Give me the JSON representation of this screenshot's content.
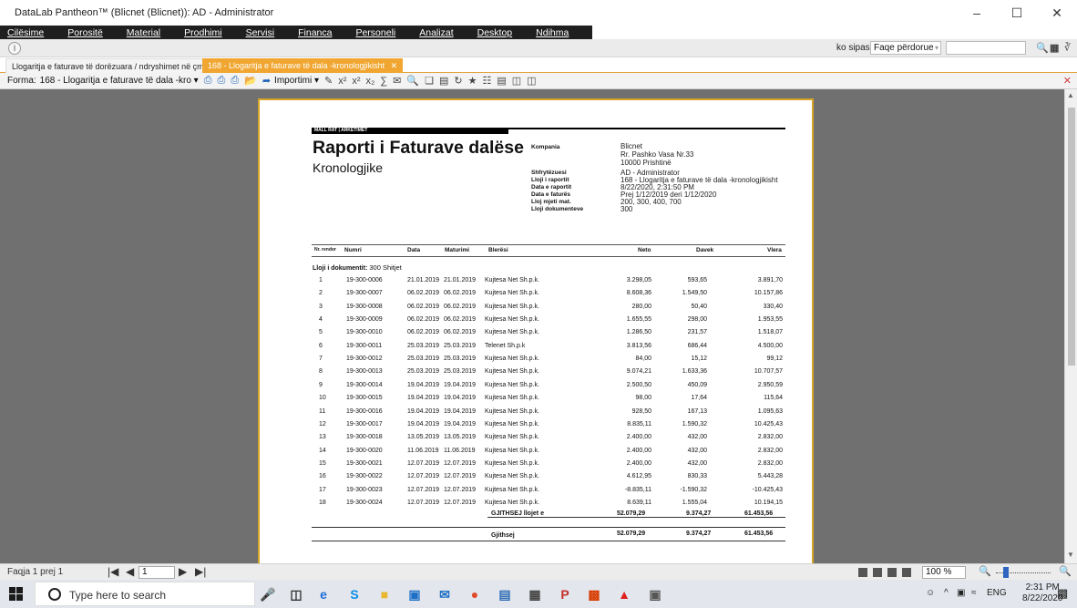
{
  "window": {
    "title": "DataLab Pantheon™  (Blicnet (Blicnet)): AD - Administrator",
    "minimize": "–",
    "maximize": "☐",
    "close": "✕"
  },
  "menu": [
    "Cilësime",
    "Porositë",
    "Material",
    "Prodhimi",
    "Servisi",
    "Financa",
    "Personeli",
    "Analizat",
    "Desktop",
    "Ndihma"
  ],
  "subbar": {
    "circle": "I",
    "sort_label": "ko sipas",
    "sort_value": "Faqe përdorue",
    "search_value": ""
  },
  "tabs": [
    {
      "label": "Llogaritja e faturave të dorëzuara / ndryshimet në çmim"
    },
    {
      "label": "168 - Llogaritja e faturave të dala  -kronologjikisht",
      "close": "✕"
    }
  ],
  "toolbar": {
    "forma_label": "Forma:",
    "forma_value": "168 - Llogaritja e faturave të dala  -kro ▾",
    "import_label": "Importimi ▾"
  },
  "report": {
    "kicker": "MALL RAT | ARKETIMET",
    "title": "Raporti i Faturave dalëse",
    "subtitle": "Kronologjike",
    "meta_labels": {
      "company": "Kompania",
      "user": "Shfrytëzuesi",
      "report_type": "Lloji i raportit",
      "report_date": "Data e raportit",
      "invoice_date": "Data e faturës",
      "account_type": "Lloj mjeti mat.",
      "doc_type": "Lloji dokumenteve"
    },
    "meta_values": {
      "company_name": "Blicnet",
      "company_addr1": "Rr. Pashko Vasa Nr.33",
      "company_addr2": "10000 Prishtinë",
      "user": "AD - Administrator",
      "report_type": "168 - Llogaritja e faturave të dala  -kronologjikisht",
      "report_date": "8/22/2020, 2:31:50 PM",
      "invoice_date": "Prej 1/12/2019 deri 1/12/2020",
      "account_type": "200, 300, 400, 700",
      "doc_type": "300"
    },
    "columns": [
      "Nr. rendor",
      "Numri",
      "Data",
      "Maturimi",
      "Blerësi",
      "Neto",
      "Davek",
      "Vlera"
    ],
    "group_label": "Lloji i dokumentit:",
    "group_value": "300   Shitjet",
    "rows": [
      [
        "1",
        "19-300-0006",
        "21.01.2019",
        "21.01.2019",
        "Kujtesa Net Sh.p.k.",
        "3.298,05",
        "593,65",
        "3.891,70"
      ],
      [
        "2",
        "19-300-0007",
        "06.02.2019",
        "06.02.2019",
        "Kujtesa Net Sh.p.k.",
        "8.608,36",
        "1.549,50",
        "10.157,86"
      ],
      [
        "3",
        "19-300-0008",
        "06.02.2019",
        "06.02.2019",
        "Kujtesa Net Sh.p.k.",
        "280,00",
        "50,40",
        "330,40"
      ],
      [
        "4",
        "19-300-0009",
        "06.02.2019",
        "06.02.2019",
        "Kujtesa Net Sh.p.k.",
        "1.655,55",
        "298,00",
        "1.953,55"
      ],
      [
        "5",
        "19-300-0010",
        "06.02.2019",
        "06.02.2019",
        "Kujtesa Net Sh.p.k.",
        "1.286,50",
        "231,57",
        "1.518,07"
      ],
      [
        "6",
        "19-300-0011",
        "25.03.2019",
        "25.03.2019",
        "Telenet Sh.p.k",
        "3.813,56",
        "686,44",
        "4.500,00"
      ],
      [
        "7",
        "19-300-0012",
        "25.03.2019",
        "25.03.2019",
        "Kujtesa Net Sh.p.k.",
        "84,00",
        "15,12",
        "99,12"
      ],
      [
        "8",
        "19-300-0013",
        "25.03.2019",
        "25.03.2019",
        "Kujtesa Net Sh.p.k.",
        "9.074,21",
        "1.633,36",
        "10.707,57"
      ],
      [
        "9",
        "19-300-0014",
        "19.04.2019",
        "19.04.2019",
        "Kujtesa Net Sh.p.k.",
        "2.500,50",
        "450,09",
        "2.950,59"
      ],
      [
        "10",
        "19-300-0015",
        "19.04.2019",
        "19.04.2019",
        "Kujtesa Net Sh.p.k.",
        "98,00",
        "17,64",
        "115,64"
      ],
      [
        "11",
        "19-300-0016",
        "19.04.2019",
        "19.04.2019",
        "Kujtesa Net Sh.p.k.",
        "928,50",
        "167,13",
        "1.095,63"
      ],
      [
        "12",
        "19-300-0017",
        "19.04.2019",
        "19.04.2019",
        "Kujtesa Net Sh.p.k.",
        "8.835,11",
        "1.590,32",
        "10.425,43"
      ],
      [
        "13",
        "19-300-0018",
        "13.05.2019",
        "13.05.2019",
        "Kujtesa Net Sh.p.k.",
        "2.400,00",
        "432,00",
        "2.832,00"
      ],
      [
        "14",
        "19-300-0020",
        "11.06.2019",
        "11.06.2019",
        "Kujtesa Net Sh.p.k.",
        "2.400,00",
        "432,00",
        "2.832,00"
      ],
      [
        "15",
        "19-300-0021",
        "12.07.2019",
        "12.07.2019",
        "Kujtesa Net Sh.p.k.",
        "2.400,00",
        "432,00",
        "2.832,00"
      ],
      [
        "16",
        "19-300-0022",
        "12.07.2019",
        "12.07.2019",
        "Kujtesa Net Sh.p.k.",
        "4.612,95",
        "830,33",
        "5.443,28"
      ],
      [
        "17",
        "19-300-0023",
        "12.07.2019",
        "12.07.2019",
        "Kujtesa Net Sh.p.k.",
        "-8.835,11",
        "-1.590,32",
        "-10.425,43"
      ],
      [
        "18",
        "19-300-0024",
        "12.07.2019",
        "12.07.2019",
        "Kujtesa Net Sh.p.k.",
        "8.639,11",
        "1.555,04",
        "10.194,15"
      ]
    ],
    "subtotal": {
      "label": "GJITHSEJ llojet e",
      "neto": "52.079,29",
      "davek": "9.374,27",
      "vlera": "61.453,56"
    },
    "total": {
      "label": "Gjithsej",
      "neto": "52.079,29",
      "davek": "9.374,27",
      "vlera": "61.453,56"
    }
  },
  "statusbar": {
    "page_label": "Faqja 1 prej 1",
    "page_input": "1",
    "zoom": "100 %"
  },
  "taskbar": {
    "search_placeholder": "Type here to search",
    "lang": "ENG",
    "time": "2:31 PM",
    "date": "8/22/2020"
  }
}
